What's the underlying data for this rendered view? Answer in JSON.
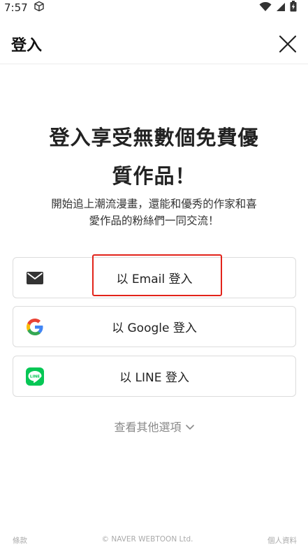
{
  "status_bar": {
    "time": "7:57",
    "icons": [
      "cube-icon",
      "wifi-icon",
      "signal-icon",
      "battery-charging-icon"
    ]
  },
  "header": {
    "title": "登入",
    "close_icon": "close-icon"
  },
  "main": {
    "headline_line1": "登入享受無數個免費優",
    "headline_line2": "質作品！",
    "subtitle_line1": "開始追上潮流漫畫，還能和優秀的作家和喜",
    "subtitle_line2": "愛作品的粉絲們一同交流！",
    "buttons": {
      "email": {
        "label": "以 Email 登入",
        "icon": "envelope-icon"
      },
      "google": {
        "label": "以 Google 登入",
        "icon": "google-logo-icon"
      },
      "line": {
        "label": "以 LINE 登入",
        "icon": "line-logo-icon",
        "icon_text": "LINE"
      }
    },
    "more_options": "查看其他選項"
  },
  "footer": {
    "terms": "條款",
    "copyright": "© NAVER WEBTOON Ltd.",
    "privacy": "個人資料"
  },
  "colors": {
    "highlight": "#e2231a",
    "line_green": "#06c755",
    "google_blue": "#4285f4",
    "google_red": "#ea4335",
    "google_yellow": "#fbbc05",
    "google_green": "#34a853"
  }
}
